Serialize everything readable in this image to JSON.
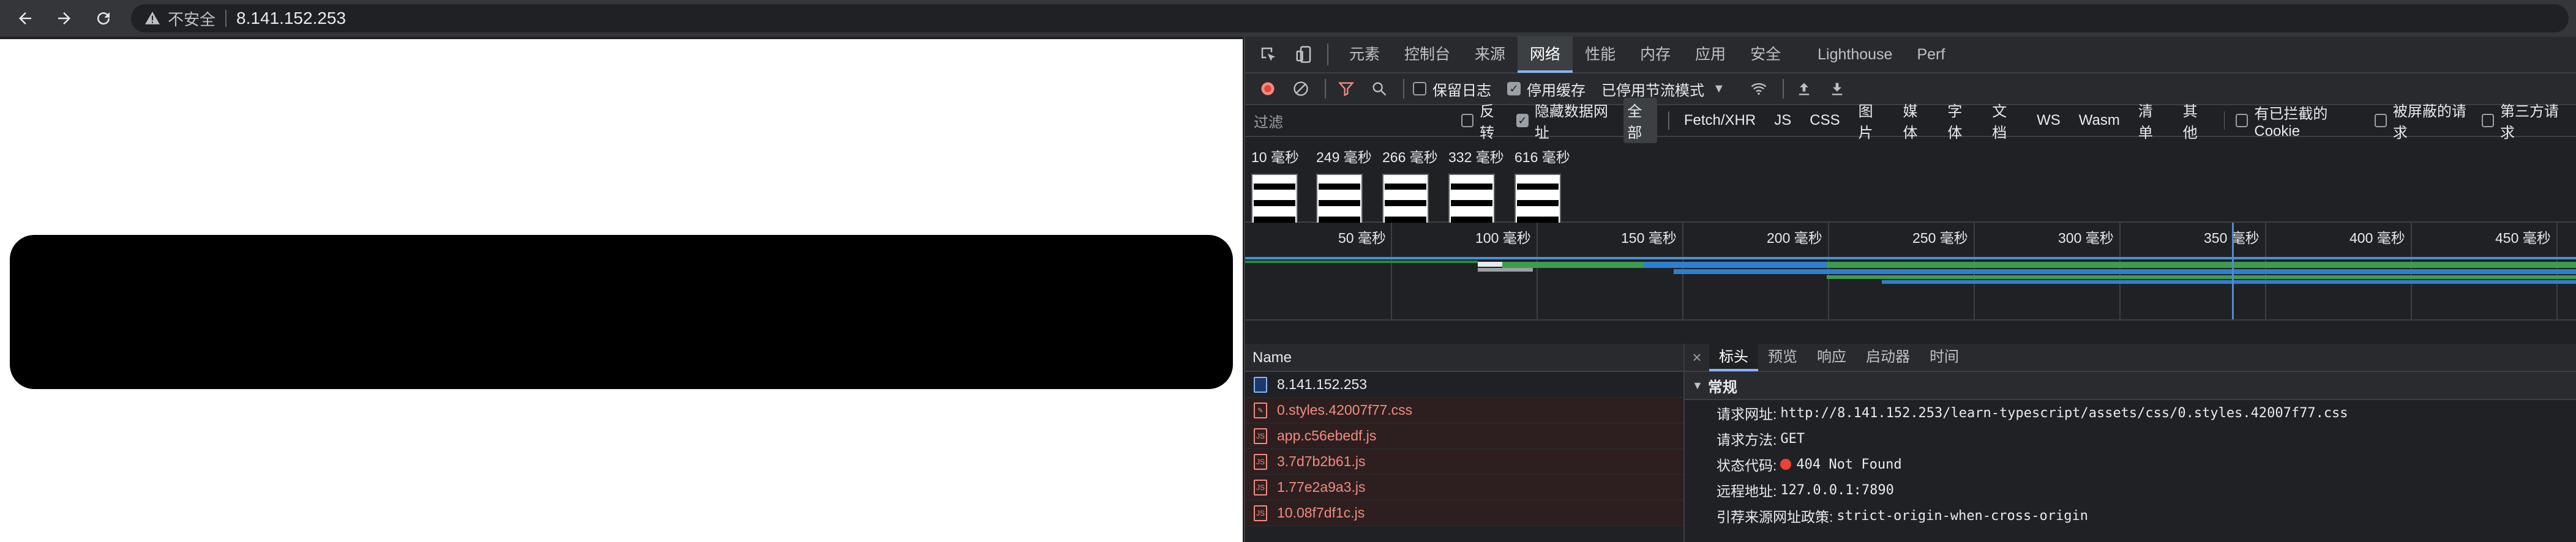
{
  "browser": {
    "insecure_label": "不安全",
    "url": "8.141.152.253"
  },
  "devtools": {
    "tabs": [
      "元素",
      "控制台",
      "来源",
      "网络",
      "性能",
      "内存",
      "应用",
      "安全",
      "Lighthouse",
      "Perf"
    ],
    "active_tab": "网络",
    "toolbar": {
      "preserve_log": "保留日志",
      "disable_cache": "停用缓存",
      "throttle": "已停用节流模式"
    },
    "filter": {
      "placeholder": "过滤",
      "invert": "反转",
      "hide_data_urls": "隐藏数据网址",
      "types": [
        "全部",
        "Fetch/XHR",
        "JS",
        "CSS",
        "图片",
        "媒体",
        "字体",
        "文档",
        "WS",
        "Wasm",
        "清单",
        "其他"
      ],
      "blocked_cookies": "有已拦截的 Cookie",
      "blocked_requests": "被屏蔽的请求",
      "third_party": "第三方请求"
    },
    "screenshots": [
      "10 毫秒",
      "249 毫秒",
      "266 毫秒",
      "332 毫秒",
      "616 毫秒"
    ],
    "overview_ticks": [
      "50 毫秒",
      "100 毫秒",
      "150 毫秒",
      "200 毫秒",
      "250 毫秒",
      "300 毫秒",
      "350 毫秒",
      "400 毫秒",
      "450 毫秒"
    ],
    "request_list": {
      "header": "Name",
      "rows": [
        {
          "name": "8.141.152.253",
          "status": "ok"
        },
        {
          "name": "0.styles.42007f77.css",
          "status": "error"
        },
        {
          "name": "app.c56ebedf.js",
          "status": "error"
        },
        {
          "name": "3.7d7b2b61.js",
          "status": "error"
        },
        {
          "name": "1.77e2a9a3.js",
          "status": "error"
        },
        {
          "name": "10.08f7df1c.js",
          "status": "error"
        }
      ]
    },
    "details": {
      "tabs": [
        "标头",
        "预览",
        "响应",
        "启动器",
        "时间"
      ],
      "active_tab": "标头",
      "section": "常规",
      "fields": [
        {
          "key": "请求网址:",
          "value": "http://8.141.152.253/learn-typescript/assets/css/0.styles.42007f77.css"
        },
        {
          "key": "请求方法:",
          "value": "GET"
        },
        {
          "key": "状态代码:",
          "value": "404 Not Found"
        },
        {
          "key": "远程地址:",
          "value": "127.0.0.1:7890"
        },
        {
          "key": "引荐来源网址政策:",
          "value": "strict-origin-when-cross-origin"
        }
      ]
    }
  }
}
